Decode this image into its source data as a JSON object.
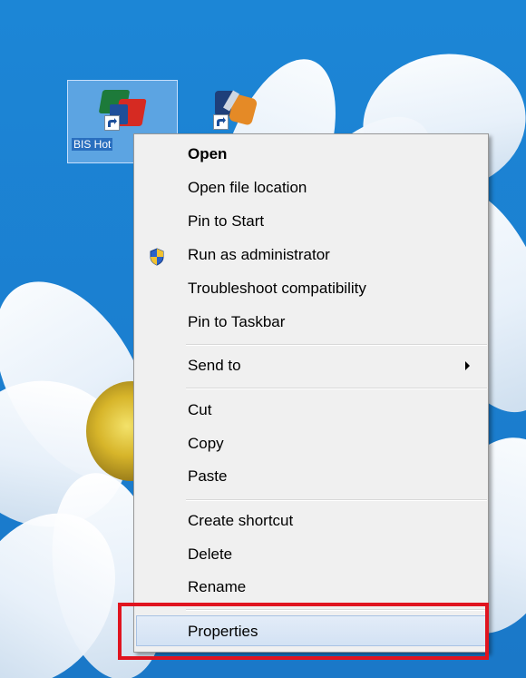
{
  "desktop": {
    "icons": [
      {
        "name": "BIS Hotel shortcut",
        "label": "BIS Hot",
        "selected": true
      },
      {
        "name": "second shortcut",
        "label": "",
        "selected": false
      }
    ]
  },
  "context_menu": {
    "items": [
      {
        "label": "Open",
        "bold": true
      },
      {
        "label": "Open file location"
      },
      {
        "label": "Pin to Start"
      },
      {
        "label": "Run as administrator",
        "icon": "uac-shield-icon"
      },
      {
        "label": "Troubleshoot compatibility"
      },
      {
        "label": "Pin to Taskbar"
      },
      {
        "label": "Send to",
        "submenu": true
      },
      {
        "label": "Cut"
      },
      {
        "label": "Copy"
      },
      {
        "label": "Paste"
      },
      {
        "label": "Create shortcut"
      },
      {
        "label": "Delete"
      },
      {
        "label": "Rename"
      },
      {
        "label": "Properties",
        "highlighted": true
      }
    ]
  },
  "annotation": {
    "color": "#e0141f",
    "target": "Properties"
  }
}
